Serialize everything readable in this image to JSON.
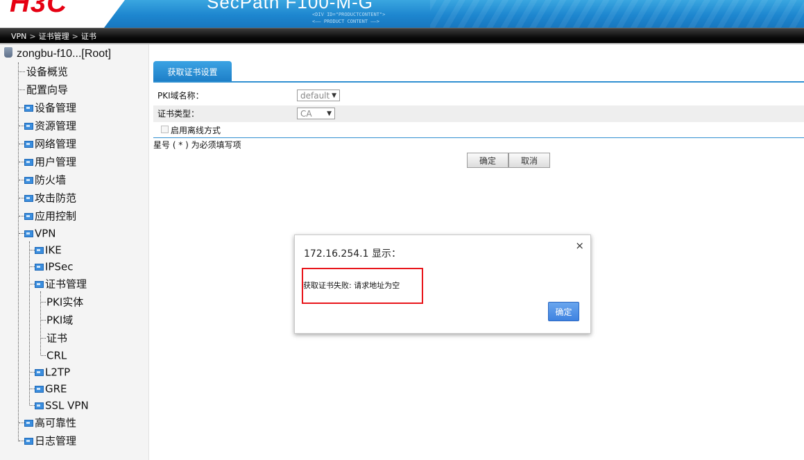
{
  "header": {
    "logo_text": "H3C",
    "product_title": "SecPath F100-M-G",
    "deco_line1": "<DIV ID=\"PRODUCTCONTENT\">",
    "deco_line2": "<—— PRODUCT CONTENT ——>"
  },
  "breadcrumb": {
    "items": [
      "VPN",
      "证书管理",
      "证书"
    ],
    "separator": ">"
  },
  "sidebar": {
    "root_label": "zongbu-f10...[Root]",
    "items": [
      {
        "label": "设备概览"
      },
      {
        "label": "配置向导"
      },
      {
        "label": "设备管理"
      },
      {
        "label": "资源管理"
      },
      {
        "label": "网络管理"
      },
      {
        "label": "用户管理"
      },
      {
        "label": "防火墙"
      },
      {
        "label": "攻击防范"
      },
      {
        "label": "应用控制"
      },
      {
        "label": "VPN"
      },
      {
        "label": "IKE"
      },
      {
        "label": "IPSec"
      },
      {
        "label": "证书管理"
      },
      {
        "label": "PKI实体"
      },
      {
        "label": "PKI域"
      },
      {
        "label": "证书"
      },
      {
        "label": "CRL"
      },
      {
        "label": "L2TP"
      },
      {
        "label": "GRE"
      },
      {
        "label": "SSL VPN"
      },
      {
        "label": "高可靠性"
      },
      {
        "label": "日志管理"
      }
    ]
  },
  "main": {
    "tab_label": "获取证书设置",
    "pki_domain_label": "PKI域名称：",
    "pki_domain_value": "default",
    "cert_type_label": "证书类型：",
    "cert_type_value": "CA",
    "offline_label": "启用离线方式",
    "offline_checked": false,
    "required_note": "星号 ( * ) 为必须填写项",
    "ok_button": "确定",
    "cancel_button": "取消"
  },
  "dialog": {
    "title": "172.16.254.1 显示：",
    "close_symbol": "×",
    "message": "获取证书失败: 请求地址为空",
    "ok_button": "确定"
  },
  "colors": {
    "accent_blue": "#2f8fd1",
    "brand_red": "#e60012",
    "highlight_red": "#e8151b"
  }
}
